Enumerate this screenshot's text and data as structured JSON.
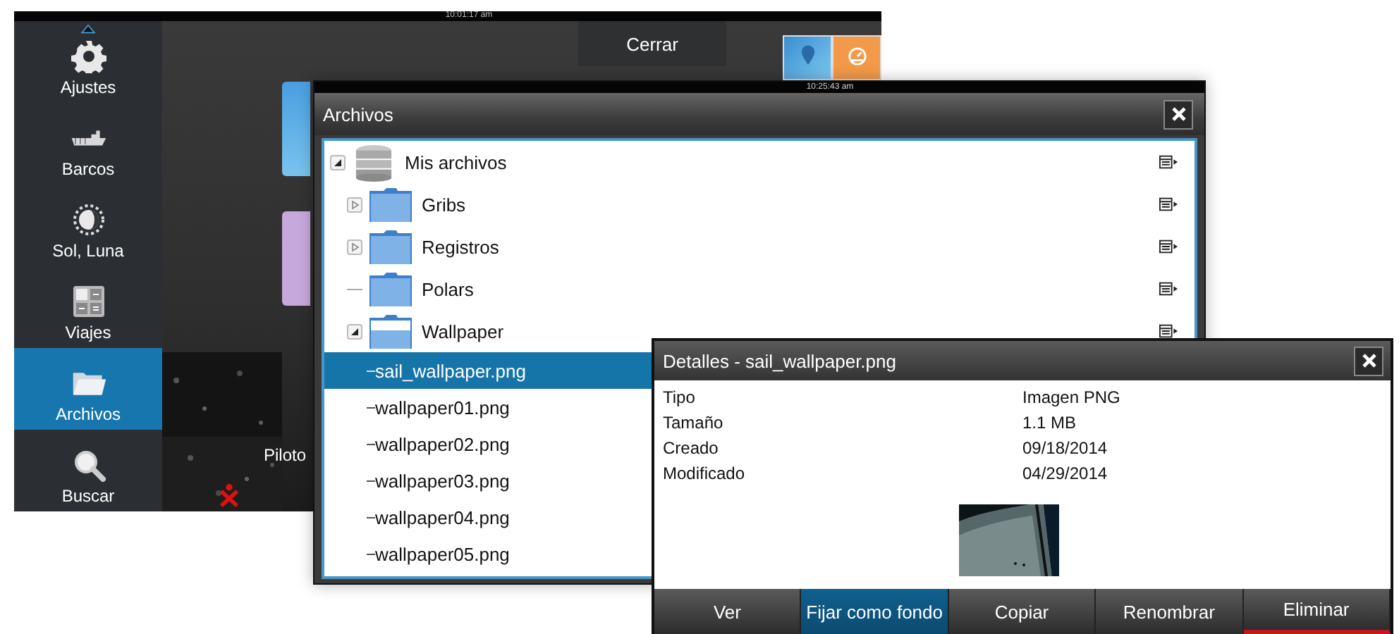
{
  "background_screen": {
    "clock": "10:01:17 am",
    "sidebar": {
      "items": [
        {
          "label": "Ajustes",
          "kind": "gear",
          "selected": false
        },
        {
          "label": "Barcos",
          "kind": "ship",
          "selected": false
        },
        {
          "label": "Sol, Luna",
          "kind": "sun-moon",
          "selected": false
        },
        {
          "label": "Viajes",
          "kind": "calculator",
          "selected": false
        },
        {
          "label": "Archivos",
          "kind": "folder",
          "selected": true
        },
        {
          "label": "Buscar",
          "kind": "search",
          "selected": false
        }
      ]
    },
    "close_label": "Cerrar",
    "tile_label": "Piloto"
  },
  "files_window": {
    "clock": "10:25:43 am",
    "title": "Archivos",
    "tree": [
      {
        "label": "Mis archivos",
        "kind": "drive",
        "expander": true,
        "expanded": true,
        "selected": false,
        "children": [
          {
            "label": "Gribs",
            "kind": "folder",
            "expander": true,
            "expanded": false,
            "selected": false
          },
          {
            "label": "Registros",
            "kind": "folder",
            "expander": true,
            "expanded": false,
            "selected": false
          },
          {
            "label": "Polars",
            "kind": "folder",
            "expander": false,
            "expanded": false,
            "selected": false
          },
          {
            "label": "Wallpaper",
            "kind": "folder",
            "expander": true,
            "expanded": true,
            "selected": false,
            "children": [
              {
                "label": "sail_wallpaper.png",
                "kind": "file",
                "selected": true
              },
              {
                "label": "wallpaper01.png",
                "kind": "file",
                "selected": false
              },
              {
                "label": "wallpaper02.png",
                "kind": "file",
                "selected": false
              },
              {
                "label": "wallpaper03.png",
                "kind": "file",
                "selected": false
              },
              {
                "label": "wallpaper04.png",
                "kind": "file",
                "selected": false
              },
              {
                "label": "wallpaper05.png",
                "kind": "file",
                "selected": false
              }
            ]
          }
        ]
      }
    ]
  },
  "details_dialog": {
    "title": "Detalles - sail_wallpaper.png",
    "properties": [
      {
        "label": "Tipo",
        "value": "Imagen PNG"
      },
      {
        "label": "Tamaño",
        "value": "1.1 MB"
      },
      {
        "label": "Creado",
        "value": "09/18/2014"
      },
      {
        "label": "Modificado",
        "value": "04/29/2014"
      }
    ],
    "buttons": [
      {
        "label": "Ver",
        "selected": false,
        "danger": false
      },
      {
        "label": "Fijar como fondo",
        "selected": true,
        "danger": false
      },
      {
        "label": "Copiar",
        "selected": false,
        "danger": false
      },
      {
        "label": "Renombrar",
        "selected": false,
        "danger": false
      },
      {
        "label": "Eliminar",
        "selected": false,
        "danger": true
      }
    ]
  }
}
